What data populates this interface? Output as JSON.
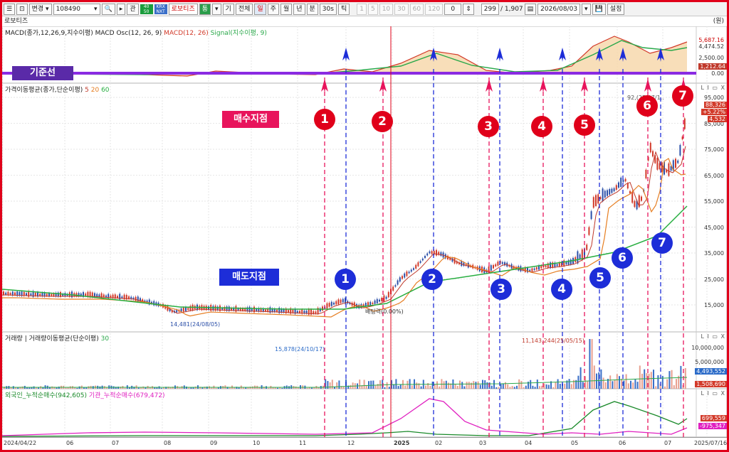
{
  "toolbar": {
    "mode": "변경",
    "code": "108490",
    "name": "로보티즈",
    "chip1": "40\n50",
    "chip2": "KRX\nNXT",
    "chip3": "통",
    "chip4": "기",
    "all": "전체",
    "periods": [
      "일",
      "주",
      "월",
      "년",
      "분",
      "30s",
      "틱"
    ],
    "intervals": [
      "1",
      "5",
      "10",
      "30",
      "60",
      "120"
    ],
    "counter": "0",
    "view_count": "299",
    "total": "/ 1,907",
    "date": "2026/08/03",
    "settings": "설정",
    "icon_ask": "관"
  },
  "stock": {
    "name": "로보티즈",
    "unit": "(원)"
  },
  "macd_panel": {
    "title_black": "MACD(종가,12,26,9,지수이평) MACD Osc(12, 26, 9)",
    "title_red": "MACD(12, 26)",
    "title_green": "Signal(지수이평, 9)",
    "labels": [
      "5,687.16",
      "4,474.52",
      "2,500.00",
      "1,212.64",
      "0.00"
    ]
  },
  "price_panel": {
    "title_black": "가격이동평균(종가,단순이평)",
    "title_p5": "5",
    "title_p20": "20",
    "title_p60": "60",
    "axis": [
      "95,000",
      "85,000",
      "75,000",
      "65,000",
      "55,000",
      "45,000",
      "35,000",
      "25,000",
      "15,000"
    ],
    "last_tags": [
      "88,326",
      "+5.22%",
      "4,532"
    ],
    "low_label": "14,481(24/08/05)",
    "high_label": "92,(25/07/1..",
    "flat_label": "배팅력(0.00%)"
  },
  "volume_panel": {
    "title_black": "거래량",
    "title_ma": "거래량이동평균(단순이평)",
    "title_n": "30",
    "axis": [
      "10,000,000",
      "5,000,000",
      "0"
    ],
    "tag_vol": "4,493,552",
    "tag_ma": "1,508,690",
    "min_label": "15,878(24/10/17)",
    "max_label": "11,143,244(25/05/15)"
  },
  "flow_panel": {
    "title_foreign": "외국인_누적순매수(942,605)",
    "title_inst": "기관_누적순매수(679,472)",
    "tag1": "699,559",
    "tag2": "-975,347"
  },
  "xaxis": [
    "2024/04/22",
    "06",
    "07",
    "08",
    "09",
    "10",
    "11",
    "12",
    "2025",
    "02",
    "03",
    "04",
    "05",
    "06",
    "07",
    "2025/07/16"
  ],
  "annotations": {
    "kijun": "기준선",
    "buy": "매수지점",
    "sell": "매도지점",
    "buy_numbers": [
      "1",
      "2",
      "3",
      "4",
      "5",
      "6",
      "7"
    ],
    "sell_numbers": [
      "1",
      "2",
      "3",
      "4",
      "5",
      "6",
      "7"
    ]
  },
  "colors": {
    "buy": "#e8145c",
    "sell": "#1d2dd8",
    "frame": "#e0001a",
    "kijun": "#5a2aa8"
  }
}
